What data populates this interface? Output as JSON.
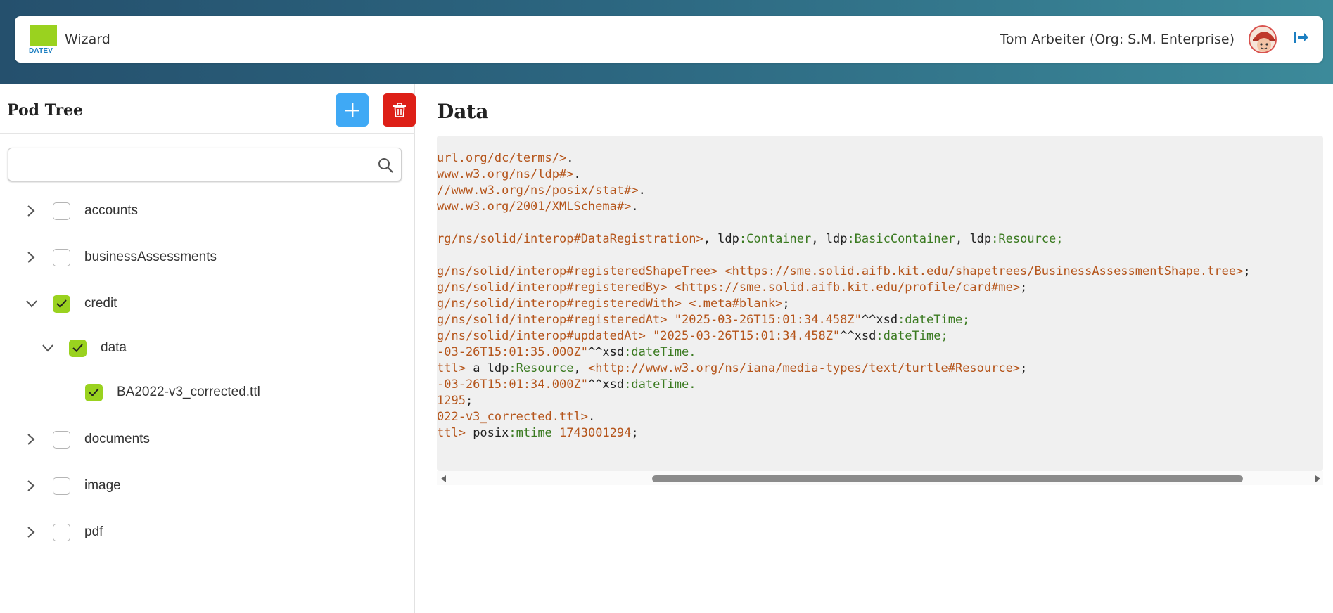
{
  "header": {
    "logo_text": "DATEV",
    "app_name": "Wizard",
    "user_label": "Tom Arbeiter (Org: S.M. Enterprise)",
    "logout_icon": "logout-arrow-icon"
  },
  "sidebar": {
    "title": "Pod Tree",
    "add_icon": "plus-icon",
    "delete_icon": "trash-icon",
    "search": {
      "placeholder": "",
      "value": ""
    },
    "tree": [
      {
        "label": "accounts",
        "expanded": false,
        "checked": false,
        "level": 0
      },
      {
        "label": "businessAssessments",
        "expanded": false,
        "checked": false,
        "level": 0
      },
      {
        "label": "credit",
        "expanded": true,
        "checked": true,
        "level": 0
      },
      {
        "label": "data",
        "expanded": true,
        "checked": true,
        "level": 1
      },
      {
        "label": "BA2022-v3_corrected.ttl",
        "expanded": null,
        "checked": true,
        "level": 2
      },
      {
        "label": "documents",
        "expanded": false,
        "checked": false,
        "level": 0
      },
      {
        "label": "image",
        "expanded": false,
        "checked": false,
        "level": 0
      },
      {
        "label": "pdf",
        "expanded": false,
        "checked": false,
        "level": 0
      }
    ]
  },
  "main": {
    "title": "Data",
    "code_lines": [
      [
        {
          "t": "url.org/dc/terms/>",
          "c": "iri"
        },
        {
          "t": ".",
          "c": "p"
        }
      ],
      [
        {
          "t": "www.w3.org/ns/ldp#>",
          "c": "iri"
        },
        {
          "t": ".",
          "c": "p"
        }
      ],
      [
        {
          "t": "//www.w3.org/ns/posix/stat#>",
          "c": "iri"
        },
        {
          "t": ".",
          "c": "p"
        }
      ],
      [
        {
          "t": "www.w3.org/2001/XMLSchema#>",
          "c": "iri"
        },
        {
          "t": ".",
          "c": "p"
        }
      ],
      [],
      [
        {
          "t": "rg/ns/solid/interop#DataRegistration>",
          "c": "iri"
        },
        {
          "t": ", ldp",
          "c": "p"
        },
        {
          "t": ":Container",
          "c": "kw"
        },
        {
          "t": ", ldp",
          "c": "p"
        },
        {
          "t": ":BasicContainer",
          "c": "kw"
        },
        {
          "t": ", ldp",
          "c": "p"
        },
        {
          "t": ":Resource;",
          "c": "kw"
        }
      ],
      [],
      [
        {
          "t": "g/ns/solid/interop#registeredShapeTree>",
          "c": "iri"
        },
        {
          "t": " ",
          "c": "p"
        },
        {
          "t": "<https://sme.solid.aifb.kit.edu/shapetrees/BusinessAssessmentShape.tree>",
          "c": "iri"
        },
        {
          "t": ";",
          "c": "p"
        }
      ],
      [
        {
          "t": "g/ns/solid/interop#registeredBy>",
          "c": "iri"
        },
        {
          "t": " ",
          "c": "p"
        },
        {
          "t": "<https://sme.solid.aifb.kit.edu/profile/card#me>",
          "c": "iri"
        },
        {
          "t": ";",
          "c": "p"
        }
      ],
      [
        {
          "t": "g/ns/solid/interop#registeredWith>",
          "c": "iri"
        },
        {
          "t": " ",
          "c": "p"
        },
        {
          "t": "<.meta#blank>",
          "c": "iri"
        },
        {
          "t": ";",
          "c": "p"
        }
      ],
      [
        {
          "t": "g/ns/solid/interop#registeredAt>",
          "c": "iri"
        },
        {
          "t": " ",
          "c": "p"
        },
        {
          "t": "\"2025-03-26T15:01:34.458Z\"",
          "c": "lit"
        },
        {
          "t": "^^xsd",
          "c": "p"
        },
        {
          "t": ":dateTime;",
          "c": "kw"
        }
      ],
      [
        {
          "t": "g/ns/solid/interop#updatedAt>",
          "c": "iri"
        },
        {
          "t": " ",
          "c": "p"
        },
        {
          "t": "\"2025-03-26T15:01:34.458Z\"",
          "c": "lit"
        },
        {
          "t": "^^xsd",
          "c": "p"
        },
        {
          "t": ":dateTime;",
          "c": "kw"
        }
      ],
      [
        {
          "t": "-03-26T15:01:35.000Z\"",
          "c": "lit"
        },
        {
          "t": "^^xsd",
          "c": "p"
        },
        {
          "t": ":dateTime.",
          "c": "kw"
        }
      ],
      [
        {
          "t": "ttl>",
          "c": "iri"
        },
        {
          "t": " a ldp",
          "c": "p"
        },
        {
          "t": ":Resource",
          "c": "kw"
        },
        {
          "t": ", ",
          "c": "p"
        },
        {
          "t": "<http://www.w3.org/ns/iana/media-types/text/turtle#Resource>",
          "c": "iri"
        },
        {
          "t": ";",
          "c": "p"
        }
      ],
      [
        {
          "t": "-03-26T15:01:34.000Z\"",
          "c": "lit"
        },
        {
          "t": "^^xsd",
          "c": "p"
        },
        {
          "t": ":dateTime.",
          "c": "kw"
        }
      ],
      [
        {
          "t": "1295",
          "c": "lit"
        },
        {
          "t": ";",
          "c": "p"
        }
      ],
      [
        {
          "t": "022-v3_corrected.ttl>",
          "c": "iri"
        },
        {
          "t": ".",
          "c": "p"
        }
      ],
      [
        {
          "t": "ttl>",
          "c": "iri"
        },
        {
          "t": " posix",
          "c": "p"
        },
        {
          "t": ":mtime",
          "c": "kw"
        },
        {
          "t": " ",
          "c": "p"
        },
        {
          "t": "1743001294",
          "c": "lit"
        },
        {
          "t": ";",
          "c": "p"
        }
      ]
    ],
    "scroll_position": 0.78,
    "scroll_visible_fraction": 0.7
  },
  "colors": {
    "accent_green": "#9ad21f",
    "add_blue": "#3fa9f5",
    "delete_red": "#dd1f17",
    "iri_orange": "#b5551b",
    "keyword_green": "#3a7a20"
  }
}
